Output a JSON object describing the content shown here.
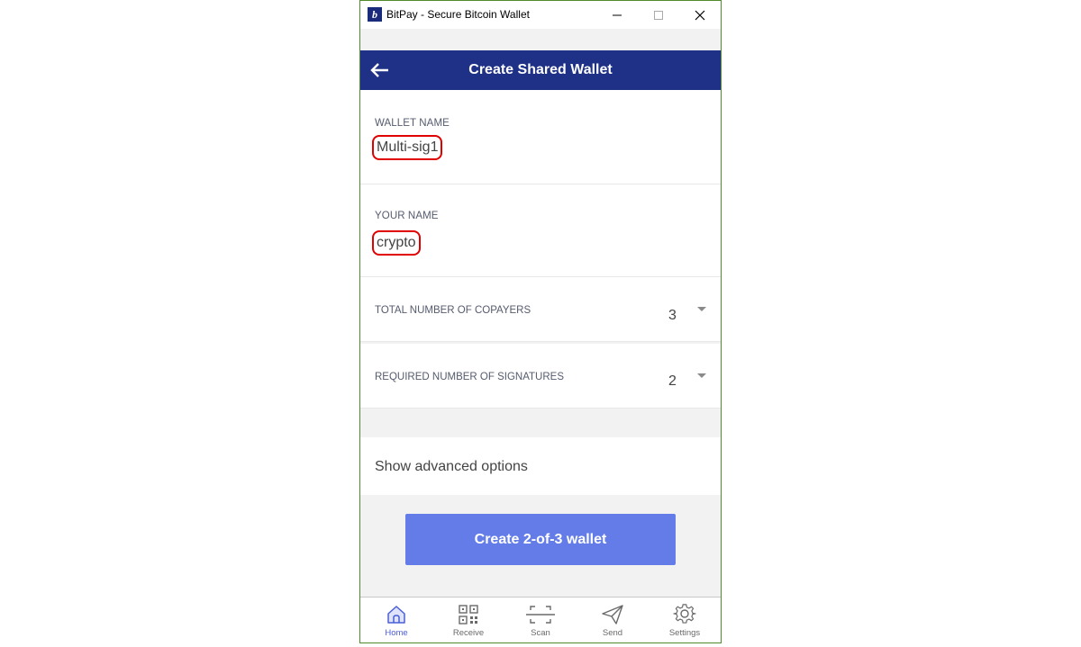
{
  "window": {
    "title": "BitPay - Secure Bitcoin Wallet",
    "border_color": "#4f8b2a"
  },
  "header": {
    "title": "Create Shared Wallet",
    "background": "#1e3186"
  },
  "form": {
    "wallet_name_label": "WALLET NAME",
    "wallet_name_value": "Multi-sig1",
    "your_name_label": "YOUR NAME",
    "your_name_value": "crypto",
    "copayers_label": "TOTAL NUMBER OF COPAYERS",
    "copayers_value": "3",
    "signatures_label": "REQUIRED NUMBER OF SIGNATURES",
    "signatures_value": "2",
    "advanced_label": "Show advanced options",
    "highlight_color": "#e00000"
  },
  "actions": {
    "create_label": "Create 2-of-3 wallet",
    "create_color": "#647ce8"
  },
  "tabs": [
    {
      "label": "Home",
      "icon": "home-icon",
      "active": true
    },
    {
      "label": "Receive",
      "icon": "qr-code-icon",
      "active": false
    },
    {
      "label": "Scan",
      "icon": "scan-icon",
      "active": false
    },
    {
      "label": "Send",
      "icon": "send-icon",
      "active": false
    },
    {
      "label": "Settings",
      "icon": "gear-icon",
      "active": false
    }
  ]
}
